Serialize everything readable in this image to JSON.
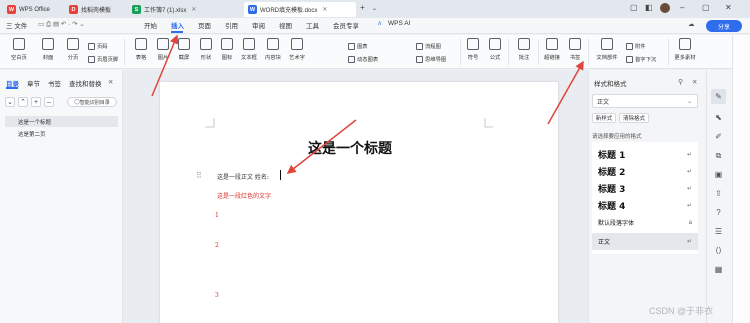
{
  "tabs": [
    {
      "label": "WPS Office",
      "icon": "wps-logo-icon",
      "color": "#e8403a",
      "glyph": "W",
      "active": false
    },
    {
      "label": "找稻壳模板",
      "icon": "docer-icon",
      "color": "#e8403a",
      "glyph": "D",
      "active": false
    },
    {
      "label": "工作簿7 (1).xlsx",
      "icon": "spreadsheet-icon",
      "color": "#18a058",
      "glyph": "S",
      "active": false
    },
    {
      "label": "WORD填充模板.docx",
      "icon": "word-doc-icon",
      "color": "#2f6ded",
      "glyph": "W",
      "active": true
    }
  ],
  "menu": {
    "file": "三 文件",
    "items": [
      "开始",
      "插入",
      "页面",
      "引用",
      "审阅",
      "视图",
      "工具",
      "会员专享",
      "WPS AI"
    ],
    "active": "插入",
    "share": "分享"
  },
  "ribbon": {
    "buttons": [
      "空白页",
      "封面",
      "分页",
      "表格",
      "图片",
      "截屏",
      "形状",
      "图标",
      "文本框",
      "内容块",
      "艺术字",
      "符号",
      "公式",
      "批注",
      "超链接",
      "书签",
      "文档部件",
      "更多素材"
    ],
    "small": [
      "页码",
      "页眉页脚",
      "图表",
      "动态图表",
      "流程图",
      "思维导图",
      "附件",
      "首字下沉"
    ]
  },
  "left_pane": {
    "tabs": [
      "目录",
      "章节",
      "书签",
      "查找和替换"
    ],
    "active_tab": "目录",
    "smart_button": "智能识别目录",
    "outline": [
      "这是一个标题",
      "这是第二页"
    ]
  },
  "document": {
    "title": "这是一个标题",
    "line1": "这是一段正文  姓名:",
    "line2": "这是一段红色的文字",
    "line_numbers": [
      "1",
      "2",
      "3"
    ]
  },
  "right_pane": {
    "title": "样式和格式",
    "current_style": "正文",
    "new_style": "新样式",
    "clear_format": "清除格式",
    "subtitle": "请选择要应用的格式",
    "styles": [
      {
        "label": "标题 1",
        "type": "heading"
      },
      {
        "label": "标题 2",
        "type": "heading"
      },
      {
        "label": "标题 3",
        "type": "heading"
      },
      {
        "label": "标题 4",
        "type": "heading"
      },
      {
        "label": "默认段落字体",
        "type": "char"
      },
      {
        "label": "正文",
        "type": "para",
        "selected": true
      }
    ]
  },
  "watermark": "CSDN @于非衣",
  "colors": {
    "accent": "#2f6ded",
    "red_text": "#d9302a",
    "arrow": "#e0443a"
  }
}
